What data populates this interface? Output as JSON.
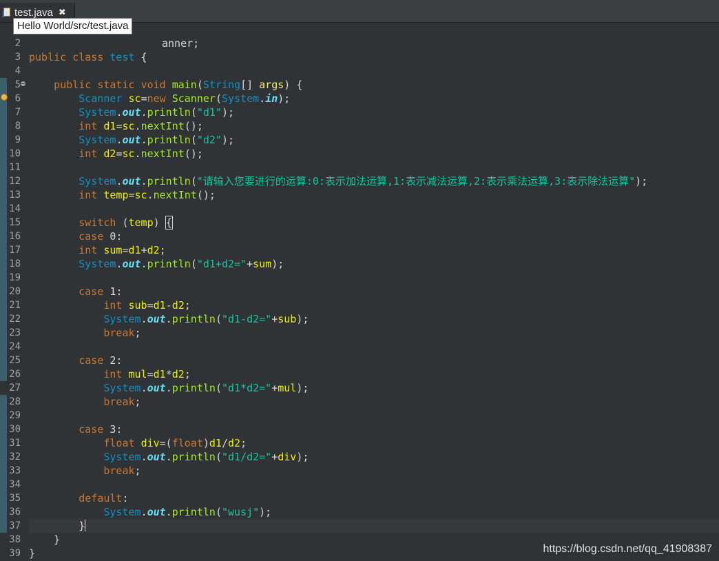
{
  "tab": {
    "label": "test.java",
    "close": "✖"
  },
  "tooltip": "Hello World/src/test.java",
  "line1_tail": "anner;",
  "lines": [
    {
      "n": "2",
      "segs": []
    },
    {
      "n": "3",
      "segs": [
        [
          "kw",
          "public "
        ],
        [
          "kw",
          "class "
        ],
        [
          "ty",
          "test"
        ],
        [
          "ot",
          " {"
        ]
      ]
    },
    {
      "n": "4",
      "segs": []
    },
    {
      "n": "5",
      "fold": true,
      "segs": [
        [
          "ot",
          "    "
        ],
        [
          "kw",
          "public "
        ],
        [
          "kw",
          "static "
        ],
        [
          "kw",
          "void "
        ],
        [
          "fn",
          "main"
        ],
        [
          "ot",
          "("
        ],
        [
          "ty",
          "String"
        ],
        [
          "ot",
          "[] "
        ],
        [
          "de",
          "args"
        ],
        [
          "ot",
          ") {"
        ]
      ]
    },
    {
      "n": "6",
      "warn": true,
      "segs": [
        [
          "ot",
          "        "
        ],
        [
          "ty",
          "Scanner "
        ],
        [
          "va",
          "sc"
        ],
        [
          "ot",
          "="
        ],
        [
          "kw",
          "new "
        ],
        [
          "fn",
          "Scanner"
        ],
        [
          "ot",
          "("
        ],
        [
          "ty",
          "System"
        ],
        [
          "ot",
          "."
        ],
        [
          "io",
          "in"
        ],
        [
          "ot",
          ");"
        ]
      ]
    },
    {
      "n": "7",
      "segs": [
        [
          "ot",
          "        "
        ],
        [
          "ty",
          "System"
        ],
        [
          "ot",
          "."
        ],
        [
          "io",
          "out"
        ],
        [
          "ot",
          "."
        ],
        [
          "fn",
          "println"
        ],
        [
          "ot",
          "("
        ],
        [
          "st",
          "\"d1\""
        ],
        [
          "ot",
          ");"
        ]
      ]
    },
    {
      "n": "8",
      "segs": [
        [
          "ot",
          "        "
        ],
        [
          "kw",
          "int "
        ],
        [
          "va",
          "d1"
        ],
        [
          "ot",
          "="
        ],
        [
          "va",
          "sc"
        ],
        [
          "ot",
          "."
        ],
        [
          "fn",
          "nextInt"
        ],
        [
          "ot",
          "();"
        ]
      ]
    },
    {
      "n": "9",
      "segs": [
        [
          "ot",
          "        "
        ],
        [
          "ty",
          "System"
        ],
        [
          "ot",
          "."
        ],
        [
          "io",
          "out"
        ],
        [
          "ot",
          "."
        ],
        [
          "fn",
          "println"
        ],
        [
          "ot",
          "("
        ],
        [
          "st",
          "\"d2\""
        ],
        [
          "ot",
          ");"
        ]
      ]
    },
    {
      "n": "10",
      "segs": [
        [
          "ot",
          "        "
        ],
        [
          "kw",
          "int "
        ],
        [
          "va",
          "d2"
        ],
        [
          "ot",
          "="
        ],
        [
          "va",
          "sc"
        ],
        [
          "ot",
          "."
        ],
        [
          "fn",
          "nextInt"
        ],
        [
          "ot",
          "();"
        ]
      ]
    },
    {
      "n": "11",
      "segs": []
    },
    {
      "n": "12",
      "segs": [
        [
          "ot",
          "        "
        ],
        [
          "ty",
          "System"
        ],
        [
          "ot",
          "."
        ],
        [
          "io",
          "out"
        ],
        [
          "ot",
          "."
        ],
        [
          "fn",
          "println"
        ],
        [
          "ot",
          "("
        ],
        [
          "st",
          "\"请输入您要进行的运算:0:表示加法运算,1:表示减法运算,2:表示乘法运算,3:表示除法运算\""
        ],
        [
          "ot",
          ");"
        ]
      ]
    },
    {
      "n": "13",
      "segs": [
        [
          "ot",
          "        "
        ],
        [
          "kw",
          "int "
        ],
        [
          "va",
          "temp"
        ],
        [
          "ot",
          "="
        ],
        [
          "va",
          "sc"
        ],
        [
          "ot",
          "."
        ],
        [
          "fn",
          "nextInt"
        ],
        [
          "ot",
          "();"
        ]
      ]
    },
    {
      "n": "14",
      "segs": []
    },
    {
      "n": "15",
      "segs": [
        [
          "ot",
          "        "
        ],
        [
          "kw",
          "switch "
        ],
        [
          "ot",
          "("
        ],
        [
          "va",
          "temp"
        ],
        [
          "ot",
          ") "
        ],
        [
          "box",
          "{"
        ]
      ]
    },
    {
      "n": "16",
      "segs": [
        [
          "ot",
          "        "
        ],
        [
          "kw",
          "case "
        ],
        [
          "ot",
          "0:"
        ]
      ]
    },
    {
      "n": "17",
      "segs": [
        [
          "ot",
          "        "
        ],
        [
          "kw",
          "int "
        ],
        [
          "va",
          "sum"
        ],
        [
          "ot",
          "="
        ],
        [
          "va",
          "d1"
        ],
        [
          "ot",
          "+"
        ],
        [
          "va",
          "d2"
        ],
        [
          "ot",
          ";"
        ]
      ]
    },
    {
      "n": "18",
      "segs": [
        [
          "ot",
          "        "
        ],
        [
          "ty",
          "System"
        ],
        [
          "ot",
          "."
        ],
        [
          "io",
          "out"
        ],
        [
          "ot",
          "."
        ],
        [
          "fn",
          "println"
        ],
        [
          "ot",
          "("
        ],
        [
          "st",
          "\"d1+d2=\""
        ],
        [
          "ot",
          "+"
        ],
        [
          "va",
          "sum"
        ],
        [
          "ot",
          ");"
        ]
      ]
    },
    {
      "n": "19",
      "segs": []
    },
    {
      "n": "20",
      "segs": [
        [
          "ot",
          "        "
        ],
        [
          "kw",
          "case "
        ],
        [
          "ot",
          "1:"
        ]
      ]
    },
    {
      "n": "21",
      "segs": [
        [
          "ot",
          "            "
        ],
        [
          "kw",
          "int "
        ],
        [
          "va",
          "sub"
        ],
        [
          "ot",
          "="
        ],
        [
          "va",
          "d1"
        ],
        [
          "ot",
          "-"
        ],
        [
          "va",
          "d2"
        ],
        [
          "ot",
          ";"
        ]
      ]
    },
    {
      "n": "22",
      "segs": [
        [
          "ot",
          "            "
        ],
        [
          "ty",
          "System"
        ],
        [
          "ot",
          "."
        ],
        [
          "io",
          "out"
        ],
        [
          "ot",
          "."
        ],
        [
          "fn",
          "println"
        ],
        [
          "ot",
          "("
        ],
        [
          "st",
          "\"d1-d2=\""
        ],
        [
          "ot",
          "+"
        ],
        [
          "va",
          "sub"
        ],
        [
          "ot",
          ");"
        ]
      ]
    },
    {
      "n": "23",
      "segs": [
        [
          "ot",
          "            "
        ],
        [
          "kw",
          "break"
        ],
        [
          "ot",
          ";"
        ]
      ]
    },
    {
      "n": "24",
      "segs": []
    },
    {
      "n": "25",
      "segs": [
        [
          "ot",
          "        "
        ],
        [
          "kw",
          "case "
        ],
        [
          "ot",
          "2:"
        ]
      ]
    },
    {
      "n": "26",
      "segs": [
        [
          "ot",
          "            "
        ],
        [
          "kw",
          "int "
        ],
        [
          "va",
          "mul"
        ],
        [
          "ot",
          "="
        ],
        [
          "va",
          "d1"
        ],
        [
          "ot",
          "*"
        ],
        [
          "va",
          "d2"
        ],
        [
          "ot",
          ";"
        ]
      ]
    },
    {
      "n": "27",
      "segs": [
        [
          "ot",
          "            "
        ],
        [
          "ty",
          "System"
        ],
        [
          "ot",
          "."
        ],
        [
          "io",
          "out"
        ],
        [
          "ot",
          "."
        ],
        [
          "fn",
          "println"
        ],
        [
          "ot",
          "("
        ],
        [
          "st",
          "\"d1*d2=\""
        ],
        [
          "ot",
          "+"
        ],
        [
          "va",
          "mul"
        ],
        [
          "ot",
          ");"
        ]
      ]
    },
    {
      "n": "28",
      "segs": [
        [
          "ot",
          "            "
        ],
        [
          "kw",
          "break"
        ],
        [
          "ot",
          ";"
        ]
      ]
    },
    {
      "n": "29",
      "segs": []
    },
    {
      "n": "30",
      "segs": [
        [
          "ot",
          "        "
        ],
        [
          "kw",
          "case "
        ],
        [
          "ot",
          "3:"
        ]
      ]
    },
    {
      "n": "31",
      "segs": [
        [
          "ot",
          "            "
        ],
        [
          "kw",
          "float "
        ],
        [
          "va",
          "div"
        ],
        [
          "ot",
          "=("
        ],
        [
          "kw",
          "float"
        ],
        [
          "ot",
          ")"
        ],
        [
          "va",
          "d1"
        ],
        [
          "ot",
          "/"
        ],
        [
          "va",
          "d2"
        ],
        [
          "ot",
          ";"
        ]
      ]
    },
    {
      "n": "32",
      "segs": [
        [
          "ot",
          "            "
        ],
        [
          "ty",
          "System"
        ],
        [
          "ot",
          "."
        ],
        [
          "io",
          "out"
        ],
        [
          "ot",
          "."
        ],
        [
          "fn",
          "println"
        ],
        [
          "ot",
          "("
        ],
        [
          "st",
          "\"d1/d2=\""
        ],
        [
          "ot",
          "+"
        ],
        [
          "va",
          "div"
        ],
        [
          "ot",
          ");"
        ]
      ]
    },
    {
      "n": "33",
      "segs": [
        [
          "ot",
          "            "
        ],
        [
          "kw",
          "break"
        ],
        [
          "ot",
          ";"
        ]
      ]
    },
    {
      "n": "34",
      "segs": []
    },
    {
      "n": "35",
      "segs": [
        [
          "ot",
          "        "
        ],
        [
          "kw",
          "default"
        ],
        [
          "ot",
          ":"
        ]
      ]
    },
    {
      "n": "36",
      "segs": [
        [
          "ot",
          "            "
        ],
        [
          "ty",
          "System"
        ],
        [
          "ot",
          "."
        ],
        [
          "io",
          "out"
        ],
        [
          "ot",
          "."
        ],
        [
          "fn",
          "println"
        ],
        [
          "ot",
          "("
        ],
        [
          "st",
          "\"wusj\""
        ],
        [
          "ot",
          ");"
        ]
      ]
    },
    {
      "n": "37",
      "current": true,
      "segs": [
        [
          "ot",
          "        "
        ],
        [
          "ot",
          "}"
        ],
        [
          "caret",
          ""
        ]
      ]
    },
    {
      "n": "38",
      "segs": [
        [
          "ot",
          "    "
        ],
        [
          "ot",
          "}"
        ]
      ]
    },
    {
      "n": "39",
      "segs": [
        [
          "ot",
          "}"
        ]
      ]
    }
  ],
  "watermark": "https://blog.csdn.net/qq_41908387"
}
